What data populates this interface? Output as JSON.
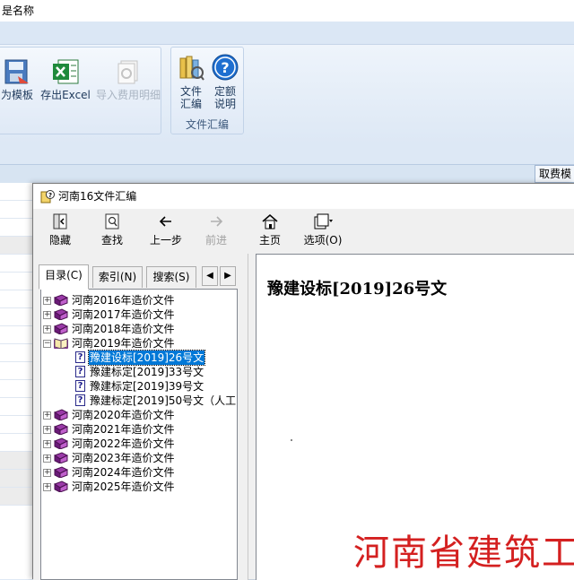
{
  "app": {
    "title_fragment": "是名称",
    "right_tab_label": "取费模"
  },
  "ribbon": {
    "buttons": [
      {
        "label": "为模板",
        "icon": "save-template-icon"
      },
      {
        "label": "存出Excel",
        "icon": "excel-icon"
      },
      {
        "label": "导入费用明细",
        "icon": "import-detail-icon",
        "disabled": true
      }
    ],
    "group": {
      "label": "文件汇编",
      "buttons": [
        {
          "label_line1": "文件",
          "label_line2": "汇编",
          "icon": "books-icon"
        },
        {
          "label_line1": "定额",
          "label_line2": "说明",
          "icon": "help-icon"
        }
      ]
    }
  },
  "help_window": {
    "title": "河南16文件汇编",
    "toolbar": {
      "hide": "隐藏",
      "find": "查找",
      "back": "上一步",
      "forward": "前进",
      "home": "主页",
      "options": "选项(O)"
    },
    "tabs": {
      "contents": "目录(C)",
      "index": "索引(N)",
      "search": "搜索(S)"
    },
    "tree": {
      "items": [
        {
          "label": "河南2016年造价文件",
          "type": "book",
          "expanded": false
        },
        {
          "label": "河南2017年造价文件",
          "type": "book",
          "expanded": false
        },
        {
          "label": "河南2018年造价文件",
          "type": "book",
          "expanded": false
        },
        {
          "label": "河南2019年造价文件",
          "type": "book-open",
          "expanded": true
        },
        {
          "label": "豫建设标[2019]26号文",
          "type": "page",
          "selected": true
        },
        {
          "label": "豫建标定[2019]33号文",
          "type": "page"
        },
        {
          "label": "豫建标定[2019]39号文",
          "type": "page"
        },
        {
          "label": "豫建标定[2019]50号文（人工",
          "type": "page"
        },
        {
          "label": "河南2020年造价文件",
          "type": "book",
          "expanded": false
        },
        {
          "label": "河南2021年造价文件",
          "type": "book",
          "expanded": false
        },
        {
          "label": "河南2022年造价文件",
          "type": "book",
          "expanded": false
        },
        {
          "label": "河南2023年造价文件",
          "type": "book",
          "expanded": false
        },
        {
          "label": "河南2024年造价文件",
          "type": "book",
          "expanded": false
        },
        {
          "label": "河南2025年造价文件",
          "type": "book",
          "expanded": false
        }
      ]
    },
    "content": {
      "heading": "豫建设标[2019]26号文",
      "banner": "河南省建筑工"
    }
  }
}
